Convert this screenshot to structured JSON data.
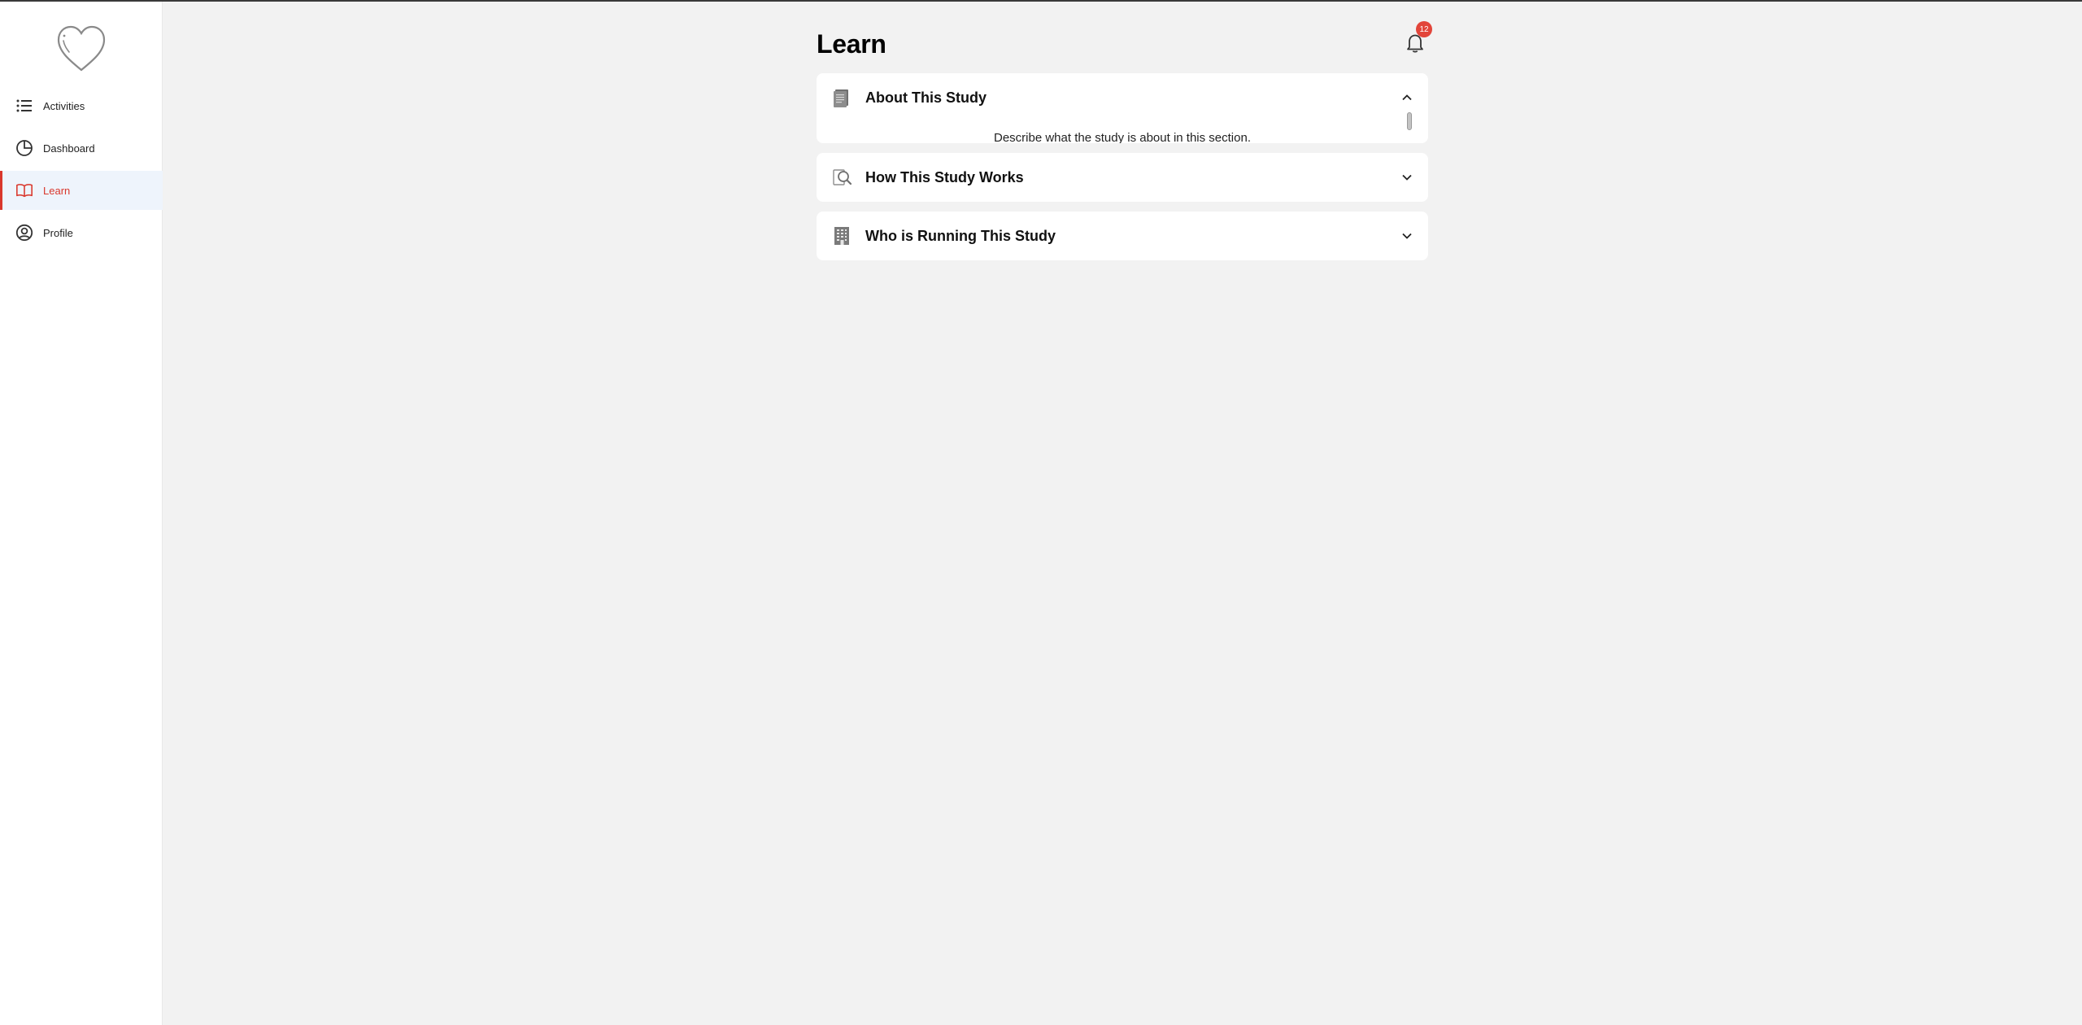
{
  "sidebar": {
    "items": [
      {
        "label": "Activities",
        "icon": "list-icon"
      },
      {
        "label": "Dashboard",
        "icon": "pie-chart-icon"
      },
      {
        "label": "Learn",
        "icon": "book-open-icon",
        "active": true
      },
      {
        "label": "Profile",
        "icon": "user-circle-icon"
      }
    ]
  },
  "header": {
    "title": "Learn",
    "notification_count": "12"
  },
  "sections": [
    {
      "title": "About This Study",
      "expanded": true,
      "body": "Describe what the study is about in this section.",
      "icon": "document-icon"
    },
    {
      "title": "How This Study Works",
      "expanded": false,
      "icon": "magnifier-document-icon"
    },
    {
      "title": "Who is Running This Study",
      "expanded": false,
      "icon": "building-icon"
    }
  ],
  "colors": {
    "accent": "#d9372c",
    "active_bg": "#eef4fc",
    "page_bg": "#f2f2f2",
    "badge": "#e2453a"
  }
}
